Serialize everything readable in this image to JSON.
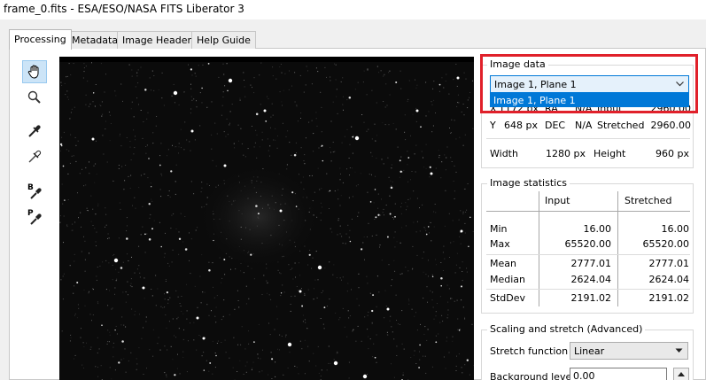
{
  "window": {
    "title": "frame_0.fits - ESA/ESO/NASA FITS Liberator 3"
  },
  "tabs": [
    {
      "label": "Processing",
      "active": true
    },
    {
      "label": "Metadata",
      "active": false
    },
    {
      "label": "Image Headers",
      "active": false
    },
    {
      "label": "Help Guide",
      "active": false
    }
  ],
  "toolbar": {
    "tools": [
      {
        "icon": "hand-icon",
        "active": true
      },
      {
        "icon": "magnifier-icon",
        "active": false
      },
      {
        "icon": "eyedropper-icon",
        "active": false
      },
      {
        "icon": "eyedropper-plus-icon",
        "active": false
      },
      {
        "icon": "eyedropper-black-icon",
        "letter": "B",
        "active": false
      },
      {
        "icon": "eyedropper-peak-icon",
        "letter": "P",
        "active": false
      }
    ]
  },
  "image_data": {
    "title": "Image data",
    "selected": "Image 1, Plane 1",
    "options": [
      "Image 1, Plane 1"
    ],
    "x_row": {
      "label": "X",
      "value": "1172 px",
      "coord_label": "RA",
      "coord_value": "N/A",
      "kind_label": "Input",
      "kind_value": "2960.00"
    },
    "y_row": {
      "label": "Y",
      "value": "648 px",
      "coord_label": "DEC",
      "coord_value": "N/A",
      "kind_label": "Stretched",
      "kind_value": "2960.00"
    },
    "size_row": {
      "width_label": "Width",
      "width_value": "1280 px",
      "height_label": "Height",
      "height_value": "960 px"
    }
  },
  "image_statistics": {
    "title": "Image statistics",
    "col_input": "Input",
    "col_stretched": "Stretched",
    "rows": [
      {
        "label": "Min",
        "input": "16.00",
        "stretched": "16.00"
      },
      {
        "label": "Max",
        "input": "65520.00",
        "stretched": "65520.00"
      },
      {
        "label": "Mean",
        "input": "2777.01",
        "stretched": "2777.01"
      },
      {
        "label": "Median",
        "input": "2624.04",
        "stretched": "2624.04"
      },
      {
        "label": "StdDev",
        "input": "2191.02",
        "stretched": "2191.02"
      }
    ]
  },
  "scaling": {
    "title": "Scaling and stretch (Advanced)",
    "stretch_label": "Stretch function",
    "stretch_value": "Linear",
    "background_label": "Background level",
    "background_value": "0.00"
  },
  "colors": {
    "highlight": "#e0202a",
    "selection": "#0078d7",
    "viewer_bg": "#0a0a0a"
  }
}
